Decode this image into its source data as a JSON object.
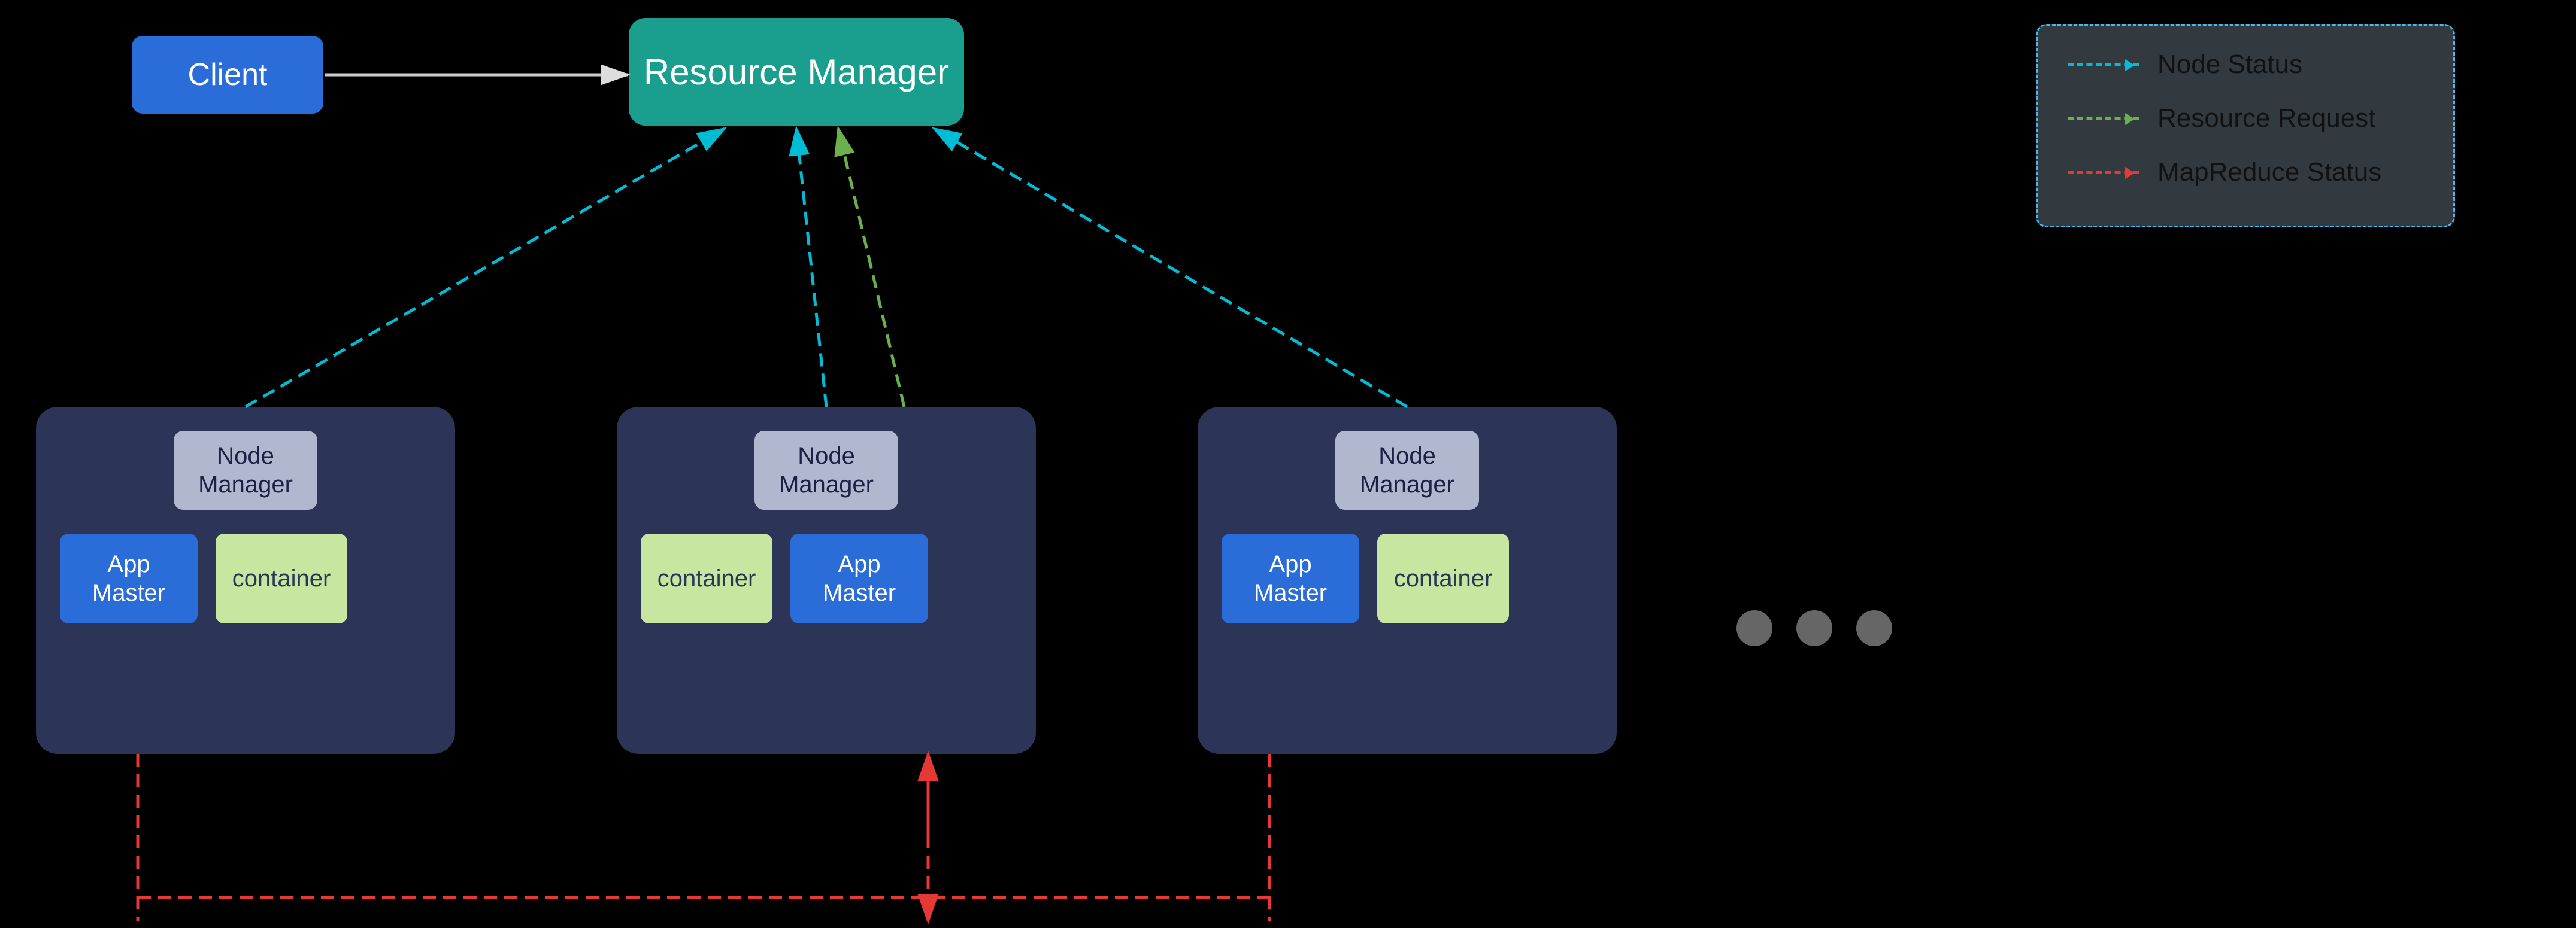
{
  "client": {
    "label": "Client"
  },
  "resource_manager": {
    "label": "Resource Manager"
  },
  "legend": {
    "items": [
      {
        "type": "cyan",
        "label": "Node Status"
      },
      {
        "type": "green",
        "label": "Resource Request"
      },
      {
        "type": "red",
        "label": "MapReduce Status"
      }
    ]
  },
  "nodes": [
    {
      "id": 1,
      "node_manager_label": "Node\nManager",
      "items": [
        {
          "type": "app_master",
          "label": "App\nMaster"
        },
        {
          "type": "container",
          "label": "container"
        }
      ]
    },
    {
      "id": 2,
      "node_manager_label": "Node\nManager",
      "items": [
        {
          "type": "container",
          "label": "container"
        },
        {
          "type": "app_master",
          "label": "App\nMaster"
        }
      ]
    },
    {
      "id": 3,
      "node_manager_label": "Node\nManager",
      "items": [
        {
          "type": "app_master",
          "label": "App\nMaster"
        },
        {
          "type": "container",
          "label": "container"
        }
      ]
    }
  ],
  "dots": {
    "count": 3
  }
}
